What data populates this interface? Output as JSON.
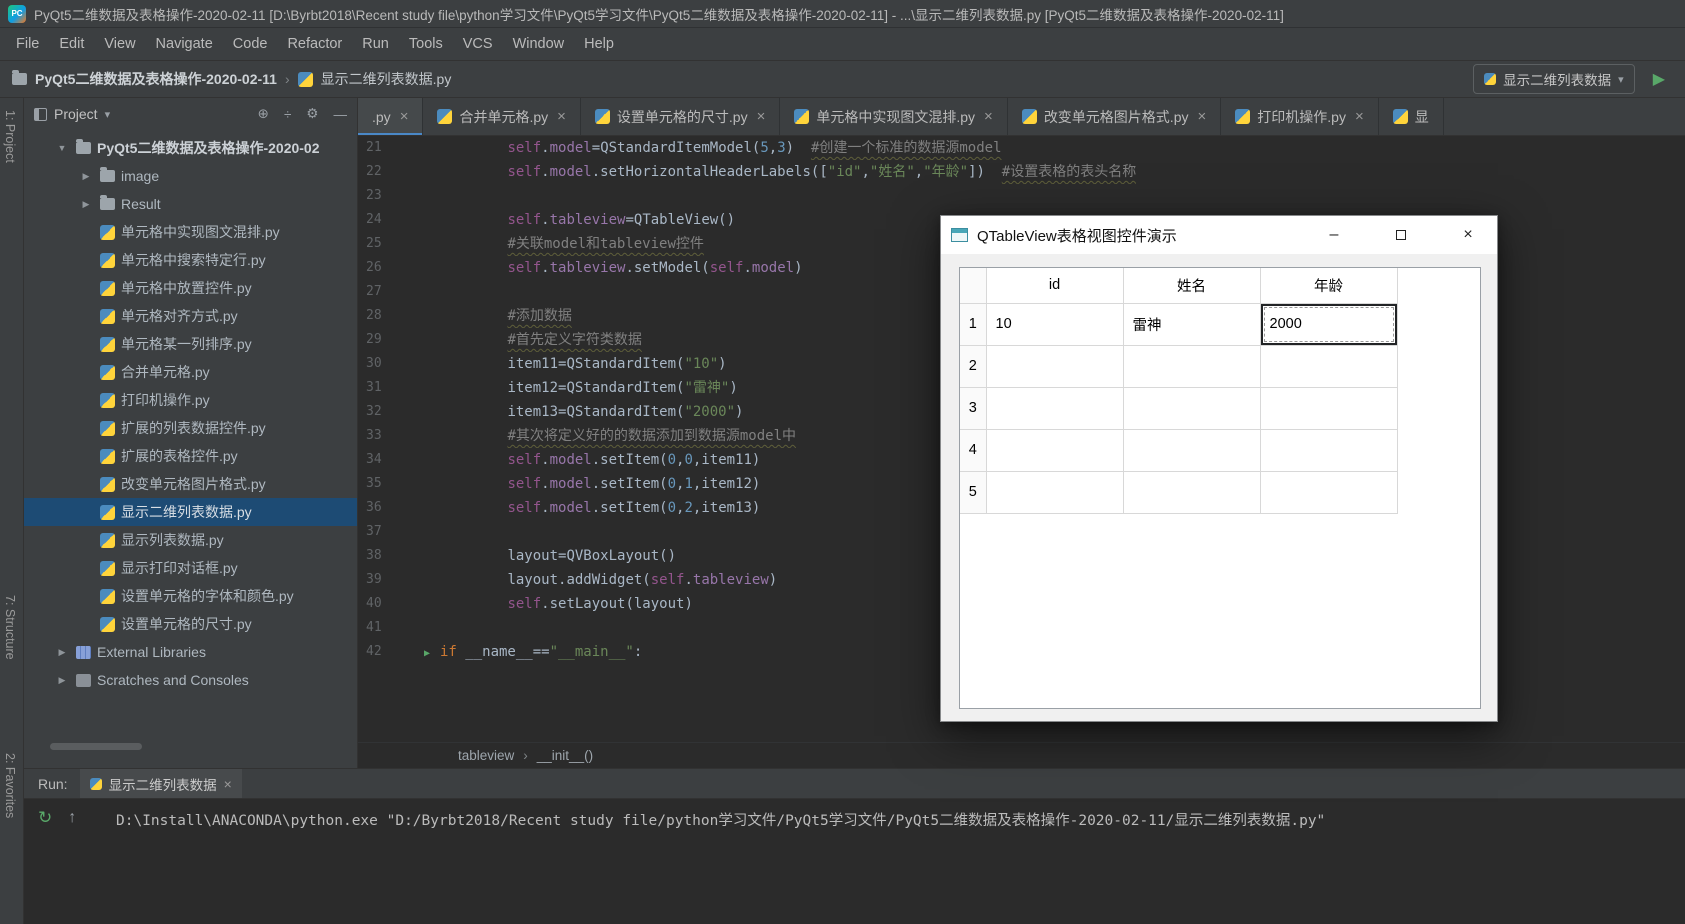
{
  "titlebar": {
    "logo_text": "PC",
    "title": "PyQt5二维数据及表格操作-2020-02-11 [D:\\Byrbt2018\\Recent study file\\python学习文件\\PyQt5学习文件\\PyQt5二维数据及表格操作-2020-02-11] - ...\\显示二维列表数据.py [PyQt5二维数据及表格操作-2020-02-11]"
  },
  "menubar": [
    "File",
    "Edit",
    "View",
    "Navigate",
    "Code",
    "Refactor",
    "Run",
    "Tools",
    "VCS",
    "Window",
    "Help"
  ],
  "navbar": {
    "project_crumb": "PyQt5二维数据及表格操作-2020-02-11",
    "separator": "›",
    "file_crumb": "显示二维列表数据.py",
    "run_config": "显示二维列表数据"
  },
  "tool_buttons": {
    "project": "1: Project",
    "structure": "7: Structure",
    "favorites": "2: Favorites"
  },
  "ui": {
    "caret_down": "▾",
    "play_glyph": "▶",
    "close_glyph": "×",
    "rerun_glyph": "↻",
    "up_glyph": "↑",
    "locate_glyph": "⊕",
    "collapse_glyph": "÷",
    "gear_glyph": "⚙",
    "minimize_glyph": "—",
    "arrow_down": "▼",
    "arrow_right": "▶"
  },
  "project": {
    "header_label": "Project",
    "items": [
      {
        "icon": "folder",
        "arrow": "down",
        "label": "PyQt5二维数据及表格操作-2020-02",
        "indent": 0,
        "bold": true
      },
      {
        "icon": "folder",
        "arrow": "right",
        "label": "image",
        "indent": 1
      },
      {
        "icon": "folder",
        "arrow": "right",
        "label": "Result",
        "indent": 1
      },
      {
        "icon": "py",
        "label": "单元格中实现图文混排.py",
        "indent": 1
      },
      {
        "icon": "py",
        "label": "单元格中搜索特定行.py",
        "indent": 1
      },
      {
        "icon": "py",
        "label": "单元格中放置控件.py",
        "indent": 1
      },
      {
        "icon": "py",
        "label": "单元格对齐方式.py",
        "indent": 1
      },
      {
        "icon": "py",
        "label": "单元格某一列排序.py",
        "indent": 1
      },
      {
        "icon": "py",
        "label": "合并单元格.py",
        "indent": 1
      },
      {
        "icon": "py",
        "label": "打印机操作.py",
        "indent": 1
      },
      {
        "icon": "py",
        "label": "扩展的列表数据控件.py",
        "indent": 1
      },
      {
        "icon": "py",
        "label": "扩展的表格控件.py",
        "indent": 1
      },
      {
        "icon": "py",
        "label": "改变单元格图片格式.py",
        "indent": 1
      },
      {
        "icon": "py",
        "label": "显示二维列表数据.py",
        "indent": 1,
        "selected": true
      },
      {
        "icon": "py",
        "label": "显示列表数据.py",
        "indent": 1
      },
      {
        "icon": "py",
        "label": "显示打印对话框.py",
        "indent": 1
      },
      {
        "icon": "py",
        "label": "设置单元格的字体和颜色.py",
        "indent": 1
      },
      {
        "icon": "py",
        "label": "设置单元格的尺寸.py",
        "indent": 1
      },
      {
        "icon": "lib",
        "arrow": "right",
        "label": "External Libraries",
        "indent": 0
      },
      {
        "icon": "scratch",
        "arrow": "right",
        "label": "Scratches and Consoles",
        "indent": 0
      }
    ]
  },
  "editor": {
    "tabs": [
      {
        "label": ".py",
        "icon": false,
        "close": true,
        "active": true
      },
      {
        "label": "合并单元格.py",
        "icon": true,
        "close": true
      },
      {
        "label": "设置单元格的尺寸.py",
        "icon": true,
        "close": true
      },
      {
        "label": "单元格中实现图文混排.py",
        "icon": true,
        "close": true
      },
      {
        "label": "改变单元格图片格式.py",
        "icon": true,
        "close": true
      },
      {
        "label": "打印机操作.py",
        "icon": true,
        "close": true
      },
      {
        "label": "显",
        "icon": true,
        "close": false
      }
    ],
    "breadcrumb": {
      "parent": "tableview",
      "separator": "›",
      "method": "__init__()"
    },
    "lines": [
      {
        "num": 21,
        "seg": [
          [
            "t",
            "        "
          ],
          [
            "v",
            "self"
          ],
          [
            "t",
            "."
          ],
          [
            "f",
            "model"
          ],
          [
            "t",
            "="
          ],
          [
            "t",
            "QStandardItemModel("
          ],
          [
            "n",
            "5"
          ],
          [
            "t",
            ","
          ],
          [
            "n",
            "3"
          ],
          [
            "t",
            ")  "
          ],
          [
            "c",
            "#创建一个标准的数据源model"
          ]
        ]
      },
      {
        "num": 22,
        "seg": [
          [
            "t",
            "        "
          ],
          [
            "v",
            "self"
          ],
          [
            "t",
            "."
          ],
          [
            "f",
            "model"
          ],
          [
            "t",
            ".setHorizontalHeaderLabels(["
          ],
          [
            "s",
            "\"id\""
          ],
          [
            "t",
            ","
          ],
          [
            "s",
            "\"姓名\""
          ],
          [
            "t",
            ","
          ],
          [
            "s",
            "\"年龄\""
          ],
          [
            "t",
            "])  "
          ],
          [
            "c",
            "#设置表格的表头名称"
          ]
        ]
      },
      {
        "num": 23,
        "seg": []
      },
      {
        "num": 24,
        "seg": [
          [
            "t",
            "        "
          ],
          [
            "v",
            "self"
          ],
          [
            "t",
            "."
          ],
          [
            "f",
            "tableview"
          ],
          [
            "t",
            "="
          ],
          [
            "t",
            "QTableView()"
          ]
        ]
      },
      {
        "num": 25,
        "seg": [
          [
            "t",
            "        "
          ],
          [
            "c",
            "#关联model和tableview控件"
          ]
        ]
      },
      {
        "num": 26,
        "seg": [
          [
            "t",
            "        "
          ],
          [
            "v",
            "self"
          ],
          [
            "t",
            "."
          ],
          [
            "f",
            "tableview"
          ],
          [
            "t",
            ".setModel("
          ],
          [
            "v",
            "self"
          ],
          [
            "t",
            "."
          ],
          [
            "f",
            "model"
          ],
          [
            "t",
            ")"
          ]
        ]
      },
      {
        "num": 27,
        "seg": []
      },
      {
        "num": 28,
        "seg": [
          [
            "t",
            "        "
          ],
          [
            "c",
            "#添加数据"
          ]
        ]
      },
      {
        "num": 29,
        "seg": [
          [
            "t",
            "        "
          ],
          [
            "c",
            "#首先定义字符类数据"
          ]
        ]
      },
      {
        "num": 30,
        "seg": [
          [
            "t",
            "        "
          ],
          [
            "t",
            "item11=QStandardItem("
          ],
          [
            "s",
            "\"10\""
          ],
          [
            "t",
            ")"
          ]
        ]
      },
      {
        "num": 31,
        "seg": [
          [
            "t",
            "        "
          ],
          [
            "t",
            "item12=QStandardItem("
          ],
          [
            "s",
            "\"雷神\""
          ],
          [
            "t",
            ")"
          ]
        ]
      },
      {
        "num": 32,
        "seg": [
          [
            "t",
            "        "
          ],
          [
            "t",
            "item13=QStandardItem("
          ],
          [
            "s",
            "\"2000\""
          ],
          [
            "t",
            ")"
          ]
        ]
      },
      {
        "num": 33,
        "seg": [
          [
            "t",
            "        "
          ],
          [
            "c",
            "#其次将定义好的的数据添加到数据源model中"
          ]
        ]
      },
      {
        "num": 34,
        "seg": [
          [
            "t",
            "        "
          ],
          [
            "v",
            "self"
          ],
          [
            "t",
            "."
          ],
          [
            "f",
            "model"
          ],
          [
            "t",
            ".setItem("
          ],
          [
            "n",
            "0"
          ],
          [
            "t",
            ","
          ],
          [
            "n",
            "0"
          ],
          [
            "t",
            ",item11)"
          ]
        ]
      },
      {
        "num": 35,
        "seg": [
          [
            "t",
            "        "
          ],
          [
            "v",
            "self"
          ],
          [
            "t",
            "."
          ],
          [
            "f",
            "model"
          ],
          [
            "t",
            ".setItem("
          ],
          [
            "n",
            "0"
          ],
          [
            "t",
            ","
          ],
          [
            "n",
            "1"
          ],
          [
            "t",
            ",item12)"
          ]
        ]
      },
      {
        "num": 36,
        "seg": [
          [
            "t",
            "        "
          ],
          [
            "v",
            "self"
          ],
          [
            "t",
            "."
          ],
          [
            "f",
            "model"
          ],
          [
            "t",
            ".setItem("
          ],
          [
            "n",
            "0"
          ],
          [
            "t",
            ","
          ],
          [
            "n",
            "2"
          ],
          [
            "t",
            ",item13)"
          ]
        ]
      },
      {
        "num": 37,
        "seg": []
      },
      {
        "num": 38,
        "seg": [
          [
            "t",
            "        "
          ],
          [
            "t",
            "layout=QVBoxLayout()"
          ]
        ]
      },
      {
        "num": 39,
        "seg": [
          [
            "t",
            "        "
          ],
          [
            "t",
            "layout.addWidget("
          ],
          [
            "v",
            "self"
          ],
          [
            "t",
            "."
          ],
          [
            "f",
            "tableview"
          ],
          [
            "t",
            ")"
          ]
        ]
      },
      {
        "num": 40,
        "seg": [
          [
            "t",
            "        "
          ],
          [
            "v",
            "self"
          ],
          [
            "t",
            ".setLayout(layout)"
          ]
        ]
      },
      {
        "num": 41,
        "seg": []
      },
      {
        "num": 42,
        "run": true,
        "seg": [
          [
            "k",
            "if"
          ],
          [
            "t",
            " __name__=="
          ],
          [
            "s",
            "\"__main__\""
          ],
          [
            "t",
            ":"
          ]
        ]
      }
    ]
  },
  "qt_window": {
    "title": "QTableView表格视图控件演示",
    "controls": {
      "minimize": "–",
      "close": "×"
    },
    "table": {
      "columns": [
        "id",
        "姓名",
        "年龄"
      ],
      "row_headers": [
        "1",
        "2",
        "3",
        "4",
        "5"
      ],
      "rows": [
        [
          "10",
          "雷神",
          "2000"
        ],
        [
          "",
          "",
          ""
        ],
        [
          "",
          "",
          ""
        ],
        [
          "",
          "",
          ""
        ],
        [
          "",
          "",
          ""
        ]
      ],
      "focused_cell": {
        "row": 0,
        "col": 2
      }
    }
  },
  "run_panel": {
    "label": "Run:",
    "tab_label": "显示二维列表数据",
    "console_line": "D:\\Install\\ANACONDA\\python.exe \"D:/Byrbt2018/Recent study file/python学习文件/PyQt5学习文件/PyQt5二维数据及表格操作-2020-02-11/显示二维列表数据.py\""
  }
}
